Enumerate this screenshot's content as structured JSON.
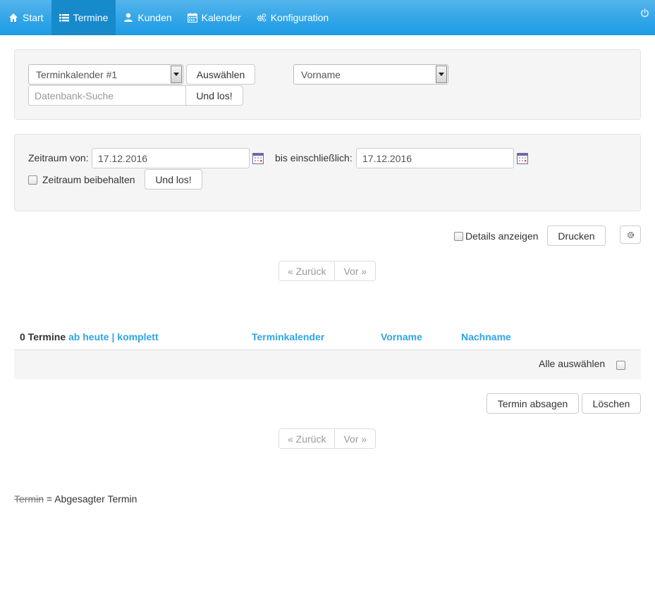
{
  "nav": {
    "items": [
      {
        "label": "Start",
        "icon": "home-icon"
      },
      {
        "label": "Termine",
        "icon": "list-icon",
        "active": true
      },
      {
        "label": "Kunden",
        "icon": "user-icon"
      },
      {
        "label": "Kalender",
        "icon": "calendar-icon"
      },
      {
        "label": "Konfiguration",
        "icon": "cogs-icon"
      }
    ],
    "power_icon": "power-icon"
  },
  "search": {
    "calendar_select_value": "Terminkalender #1",
    "select_button": "Auswählen",
    "field_select_value": "Vorname",
    "db_search_placeholder": "Datenbank-Suche",
    "go_button": "Und los!"
  },
  "range": {
    "from_label": "Zeitraum von:",
    "from_value": "17.12.2016",
    "to_label": "bis einschließlich:",
    "to_value": "17.12.2016",
    "keep_label": "Zeitraum beibehalten",
    "go_button": "Und los!"
  },
  "toolbar": {
    "details_label": "Details anzeigen",
    "print_button": "Drucken",
    "settings_icon": "gear-icon"
  },
  "pager": {
    "back": "« Zurück",
    "forward": "Vor »"
  },
  "table": {
    "count_label": "0 Termine",
    "from_today": "ab heute",
    "separator": "|",
    "complete": "komplett",
    "col_calendar": "Terminkalender",
    "col_firstname": "Vorname",
    "col_lastname": "Nachname",
    "select_all": "Alle auswählen"
  },
  "actions": {
    "cancel_button": "Termin absagen",
    "delete_button": "Löschen"
  },
  "legend": {
    "struck": "Termin",
    "text": "= Abgesagter Termin"
  },
  "colors": {
    "navbar": "#2fa4e7",
    "navbar_active": "#178acc",
    "link": "#2fa4e7"
  }
}
